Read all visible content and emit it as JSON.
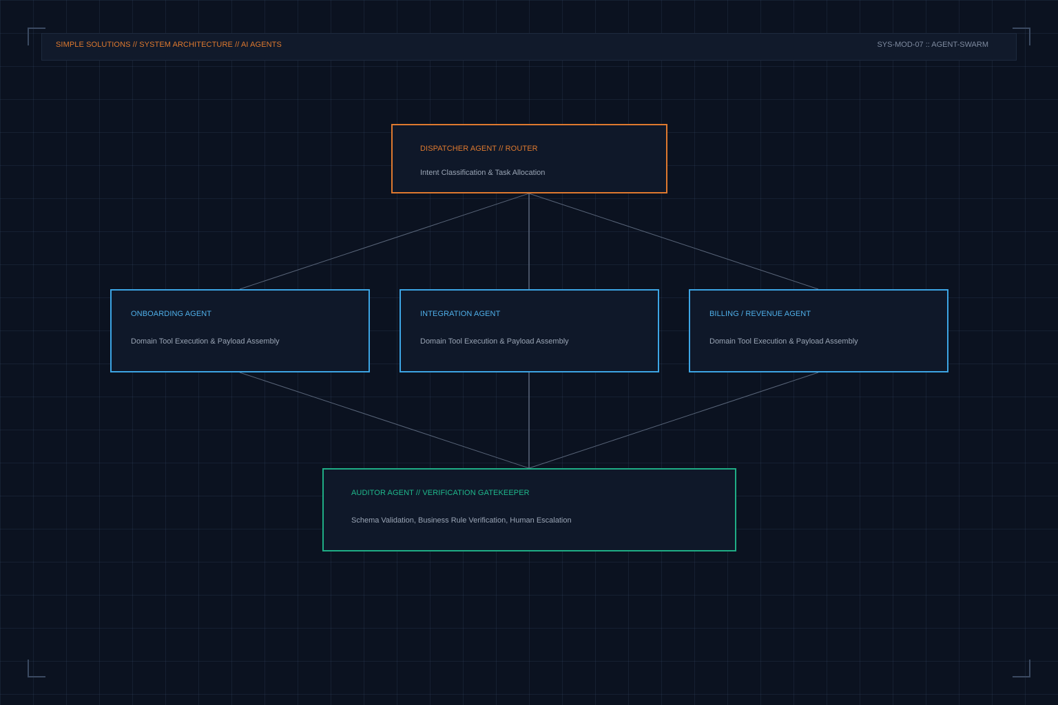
{
  "header": {
    "left_text": "SIMPLE SOLUTIONS // SYSTEM ARCHITECTURE // AI AGENTS",
    "right_text": "SYS-MOD-07 :: AGENT-SWARM"
  },
  "colors": {
    "background": "#0b1220",
    "dispatcher": "#e07a2f",
    "agents": "#3da6e6",
    "auditor": "#1fae86",
    "connector": "#5a667a"
  },
  "dispatcher": {
    "title": "DISPATCHER AGENT // ROUTER",
    "description": "Intent Classification & Task Allocation"
  },
  "agents": [
    {
      "title": "ONBOARDING AGENT",
      "description": "Domain Tool Execution & Payload Assembly"
    },
    {
      "title": "INTEGRATION AGENT",
      "description": "Domain Tool Execution & Payload Assembly"
    },
    {
      "title": "BILLING / REVENUE AGENT",
      "description": "Domain Tool Execution & Payload Assembly"
    }
  ],
  "auditor": {
    "title": "AUDITOR AGENT // VERIFICATION GATEKEEPER",
    "description": "Schema Validation, Business Rule Verification, Human Escalation"
  },
  "connections": [
    {
      "from": "dispatcher",
      "to": "onboarding"
    },
    {
      "from": "dispatcher",
      "to": "integration"
    },
    {
      "from": "dispatcher",
      "to": "billing"
    },
    {
      "from": "onboarding",
      "to": "auditor"
    },
    {
      "from": "integration",
      "to": "auditor"
    },
    {
      "from": "billing",
      "to": "auditor"
    }
  ]
}
